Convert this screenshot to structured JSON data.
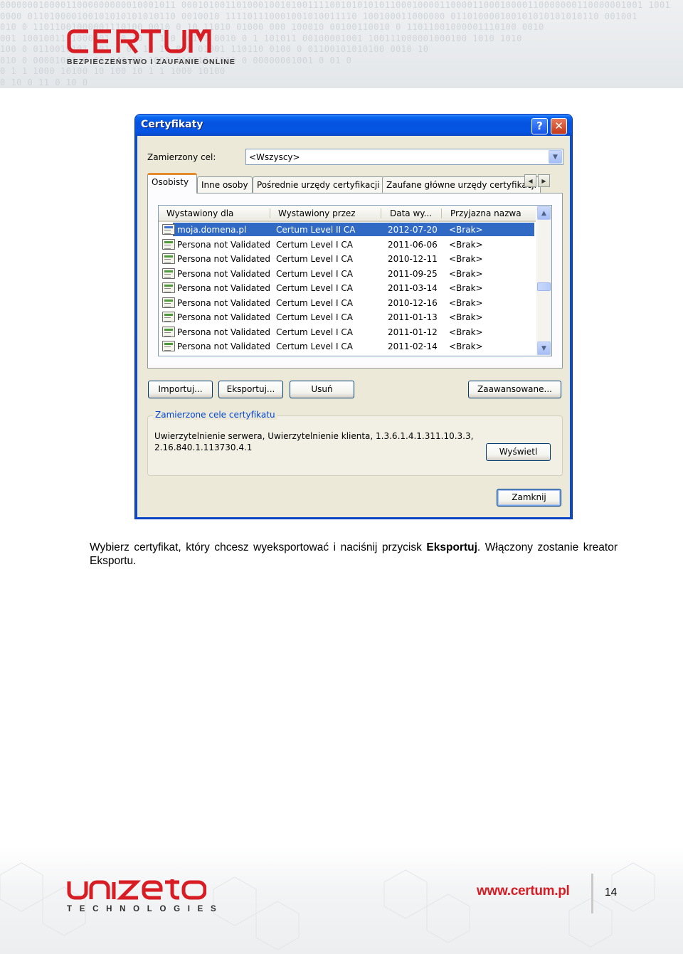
{
  "header": {
    "brand": "CERTUM",
    "tagline": "BEZPIECZEŃSTWO I ZAUFANIE ONLINE",
    "binary_rows": [
      "00000001000011000000000010001011 000101001101000100101001111001010101011000100001100001100010000110000000110000001001 1001",
      "0000 011010000100101010101010110   0010010 111101110001001010011110 100100011000000  011010000100101010101010110   001001",
      "010  0 11011001000001110100        0010 0 10 11010 01000  000 100010  00100110010  0 11011001000001110100        0010",
      "001   1001001111000001  10 10      0 1  0 00101 0010   0 1 101011   00100001001   100111000001000100 1010        1010",
      "100   0 0110010101 001 0 01        10 10   0     0 01001   110110 0100     0 01100101010100 0010      10",
      "010   0 00001001  0 01  0          0 00      1000      010010 1010    0 00000001001 0 01 0",
      "0 1   1 1000  10100                10              100 10 1   1 1000  10100",
      "         0   10 0                                   11       0   10 0"
    ]
  },
  "dialog": {
    "title": "Certyfikaty",
    "help_button": "?",
    "close_button": "✕",
    "purpose_label": "Zamierzony cel:",
    "purpose_value": "<Wszyscy>",
    "tabs": [
      {
        "label": "Osobisty",
        "active": true
      },
      {
        "label": "Inne osoby",
        "active": false
      },
      {
        "label": "Pośrednie urzędy certyfikacji",
        "active": false
      },
      {
        "label": "Zaufane główne urzędy certyfikacji",
        "active": false
      }
    ],
    "tab_scroll_left": "◀",
    "tab_scroll_right": "▶",
    "columns": [
      "Wystawiony dla",
      "Wystawiony przez",
      "Data wy...",
      "Przyjazna nazwa"
    ],
    "rows": [
      {
        "issued_to": "moja.domena.pl",
        "issued_by": "Certum Level II CA",
        "date": "2012-07-20",
        "friendly": "<Brak>",
        "selected": true
      },
      {
        "issued_to": "Persona not Validated",
        "issued_by": "Certum Level I CA",
        "date": "2011-06-06",
        "friendly": "<Brak>",
        "selected": false
      },
      {
        "issued_to": "Persona not Validated",
        "issued_by": "Certum Level I CA",
        "date": "2010-12-11",
        "friendly": "<Brak>",
        "selected": false
      },
      {
        "issued_to": "Persona not Validated",
        "issued_by": "Certum Level I CA",
        "date": "2011-09-25",
        "friendly": "<Brak>",
        "selected": false
      },
      {
        "issued_to": "Persona not Validated",
        "issued_by": "Certum Level I CA",
        "date": "2011-03-14",
        "friendly": "<Brak>",
        "selected": false
      },
      {
        "issued_to": "Persona not Validated",
        "issued_by": "Certum Level I CA",
        "date": "2010-12-16",
        "friendly": "<Brak>",
        "selected": false
      },
      {
        "issued_to": "Persona not Validated",
        "issued_by": "Certum Level I CA",
        "date": "2011-01-13",
        "friendly": "<Brak>",
        "selected": false
      },
      {
        "issued_to": "Persona not Validated",
        "issued_by": "Certum Level I CA",
        "date": "2011-01-12",
        "friendly": "<Brak>",
        "selected": false
      },
      {
        "issued_to": "Persona not Validated",
        "issued_by": "Certum Level I CA",
        "date": "2011-02-14",
        "friendly": "<Brak>",
        "selected": false
      }
    ],
    "scroll_up": "▲",
    "scroll_down": "▼",
    "buttons": {
      "import": "Importuj...",
      "export": "Eksportuj...",
      "remove": "Usuń",
      "advanced": "Zaawansowane...",
      "view": "Wyświetl",
      "close": "Zamknij"
    },
    "purposes_group": {
      "legend": "Zamierzone cele certyfikatu",
      "line1": "Uwierzytelnienie serwera, Uwierzytelnienie klienta, 1.3.6.1.4.1.311.10.3.3,",
      "line2": "2.16.840.1.113730.4.1"
    }
  },
  "instruction": {
    "part1": "Wybierz certyfikat, który chcesz wyeksportować i naciśnij przycisk ",
    "bold": "Eksportuj",
    "part2": ". Włączony zostanie kreator Eksportu."
  },
  "footer": {
    "brand": "unizeto",
    "brand_sub": "TECHNOLOGIES",
    "website": "www.certum.pl",
    "page_number": "14"
  },
  "colors": {
    "brand_red": "#d71c24",
    "xp_title_blue": "#0553e0",
    "selection_blue": "#316ac5",
    "group_legend_blue": "#0046d5"
  }
}
